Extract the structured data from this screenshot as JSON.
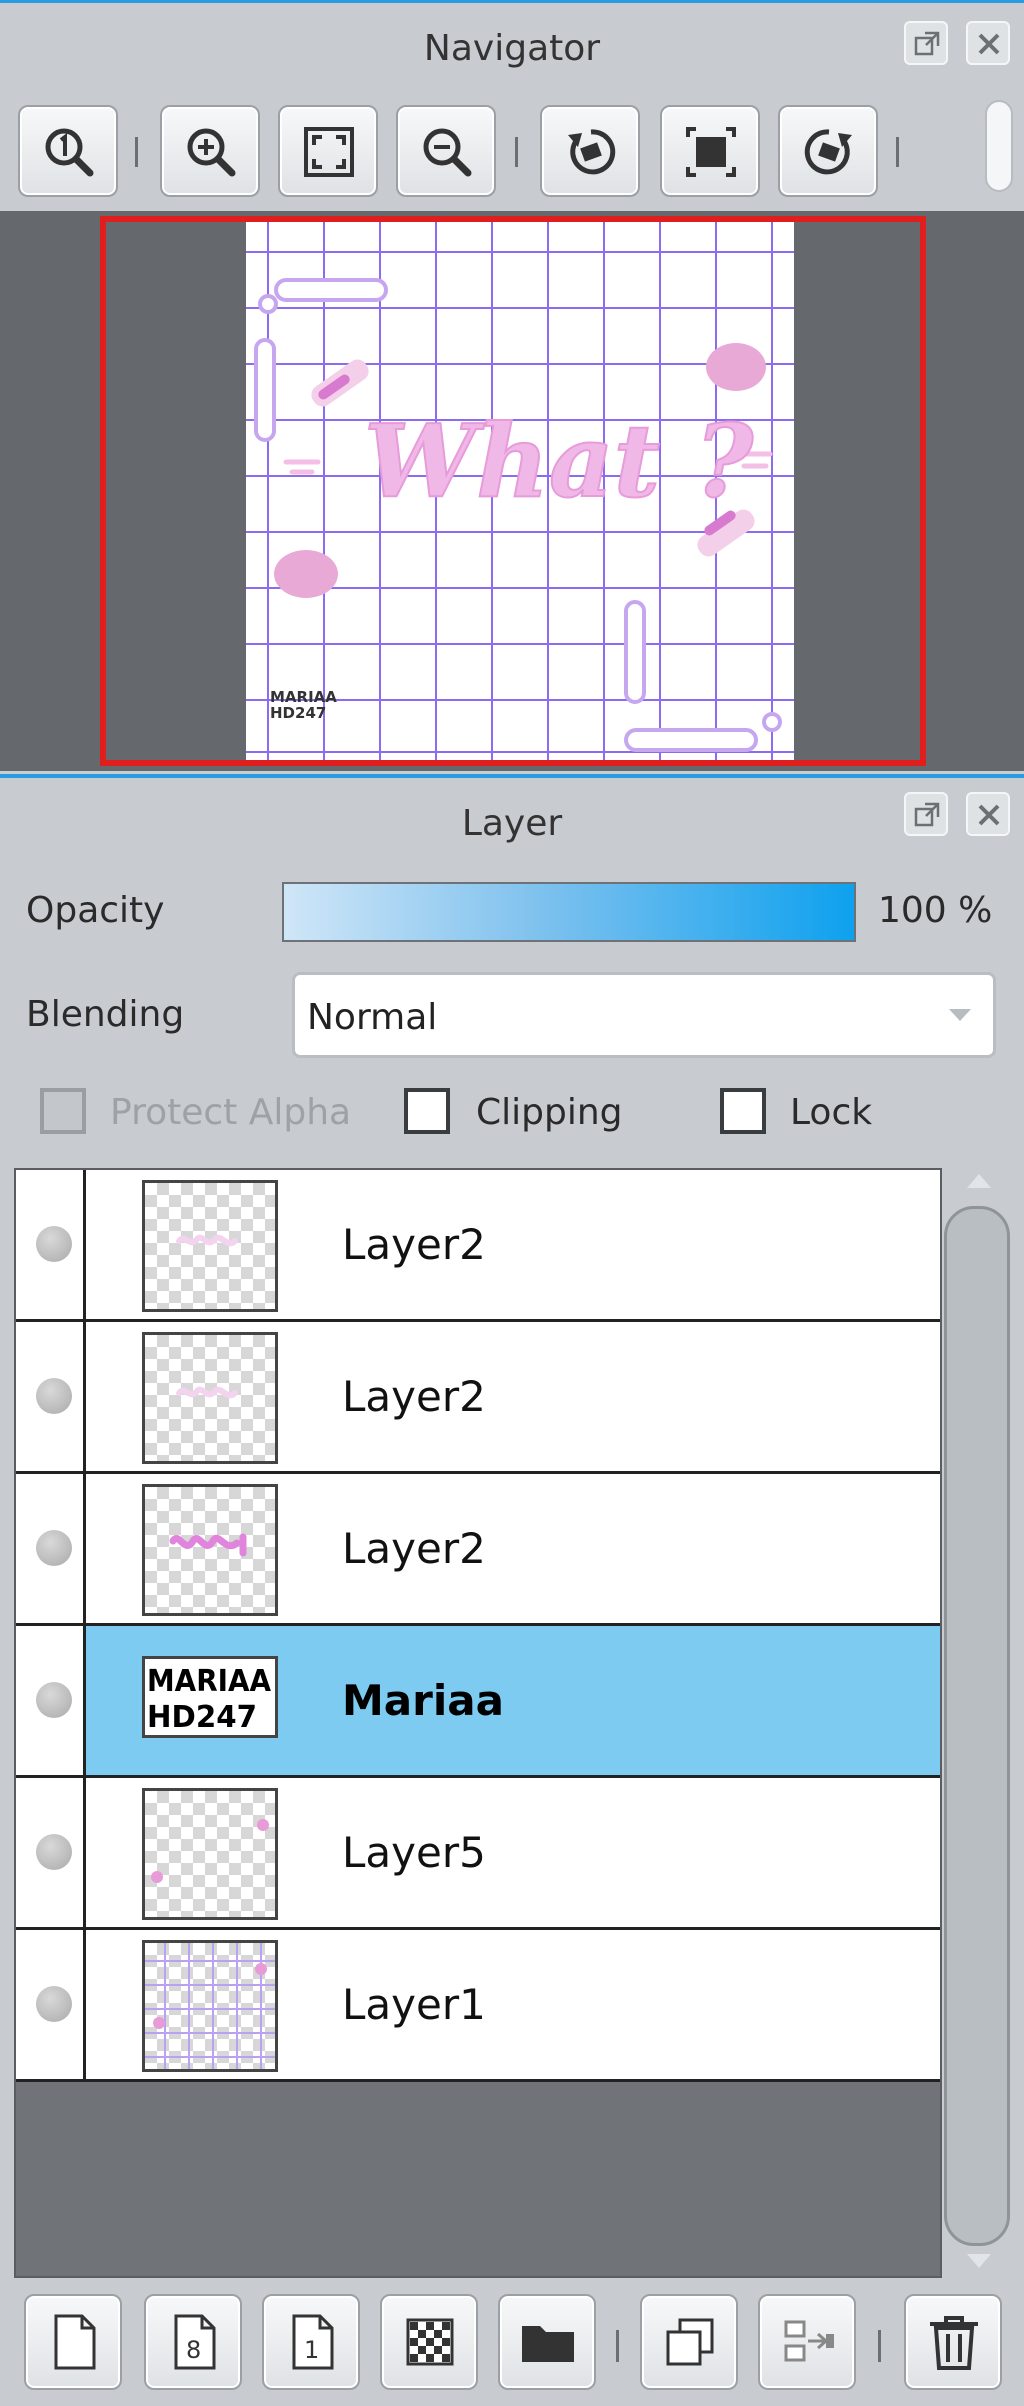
{
  "navigator": {
    "title": "Navigator",
    "toolbar": [
      {
        "name": "zoom-actual-size",
        "icon": "zoom-1-icon"
      },
      {
        "name": "zoom-in",
        "icon": "zoom-in-icon"
      },
      {
        "name": "fit-to-window",
        "icon": "fit-screen-icon"
      },
      {
        "name": "zoom-out",
        "icon": "zoom-out-icon"
      },
      {
        "name": "rotate-left",
        "icon": "rotate-left-icon"
      },
      {
        "name": "reset-rotation",
        "icon": "reset-view-icon"
      },
      {
        "name": "rotate-right",
        "icon": "rotate-right-icon"
      }
    ],
    "preview": {
      "word": "What ?",
      "signature_line1": "MARIAA",
      "signature_line2": "HD247"
    }
  },
  "layer_panel": {
    "title": "Layer",
    "opacity_label": "Opacity",
    "opacity_value": "100 %",
    "opacity_fraction": 1.0,
    "blending_label": "Blending",
    "blending_value": "Normal",
    "protect_alpha_label": "Protect Alpha",
    "clipping_label": "Clipping",
    "lock_label": "Lock",
    "layers": [
      {
        "name": "Layer2",
        "thumb": "what-faint",
        "selected": false
      },
      {
        "name": "Layer2",
        "thumb": "what-faint",
        "selected": false
      },
      {
        "name": "Layer2",
        "thumb": "what-pink",
        "selected": false
      },
      {
        "name": "Mariaa",
        "thumb": "text",
        "thumb_line1": "MARIAA",
        "thumb_line2": "HD247",
        "selected": true
      },
      {
        "name": "Layer5",
        "thumb": "dots",
        "selected": false
      },
      {
        "name": "Layer1",
        "thumb": "grid",
        "selected": false
      }
    ],
    "toolbar": [
      {
        "name": "new-layer",
        "icon": "new-page-icon"
      },
      {
        "name": "new-8bit-layer",
        "icon": "page-8-icon"
      },
      {
        "name": "new-1bit-layer",
        "icon": "page-1-icon"
      },
      {
        "name": "new-halftone-layer",
        "icon": "halftone-icon"
      },
      {
        "name": "new-folder",
        "icon": "folder-icon"
      },
      {
        "name": "duplicate-layer",
        "icon": "duplicate-icon"
      },
      {
        "name": "merge-down",
        "icon": "merge-down-icon"
      },
      {
        "name": "delete-layer",
        "icon": "trash-icon"
      }
    ],
    "colors": {
      "selected_row": "#7ecbf2",
      "opacity_fill": "#0ea1ee",
      "panel_accent": "#2a9be0"
    }
  }
}
